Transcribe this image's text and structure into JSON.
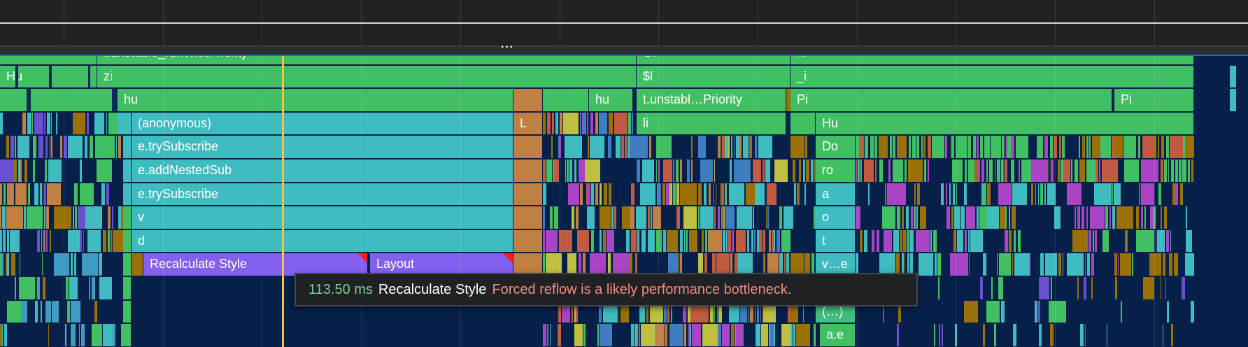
{
  "flame_rows": {
    "r0": {
      "a": "t.unstable_runWithPriority",
      "b": "Gl",
      "c": "xi"
    },
    "r1": {
      "a": "Hu",
      "b": "zi",
      "c": "$l",
      "d": "_i"
    },
    "r2": {
      "a": "hu",
      "b": "hu",
      "c": "t.unstabl…Priority",
      "d": "Pi",
      "e": "Pi"
    },
    "r3": {
      "a": "(anonymous)",
      "b": "L",
      "c": "li",
      "d": "Hu"
    },
    "r4": {
      "a": "e.trySubscribe",
      "b": "Do"
    },
    "r5": {
      "a": "e.addNestedSub",
      "b": "ro"
    },
    "r6": {
      "a": "e.trySubscribe",
      "b": "a"
    },
    "r7": {
      "a": "v",
      "b": "o"
    },
    "r8": {
      "a": "d",
      "b": "t"
    },
    "r9": {
      "a": "Recalculate Style",
      "b": "Layout",
      "c": "v…e"
    },
    "r11": {
      "a": "(…)"
    },
    "r12": {
      "a": "a.e"
    }
  },
  "tooltip": {
    "duration": "113.50 ms",
    "event_name": "Recalculate Style",
    "warning": "Forced reflow is a likely performance bottleneck."
  },
  "header": {
    "overflow_handle": "···"
  },
  "colors": {
    "background": "#07204a",
    "script_green": "#41c063",
    "function_cyan": "#3fbcc0",
    "rendering_purple": "#8460f0",
    "brown": "#c07f43",
    "cursor_yellow": "#f5c242",
    "warning_red": "#ff1a1a"
  }
}
